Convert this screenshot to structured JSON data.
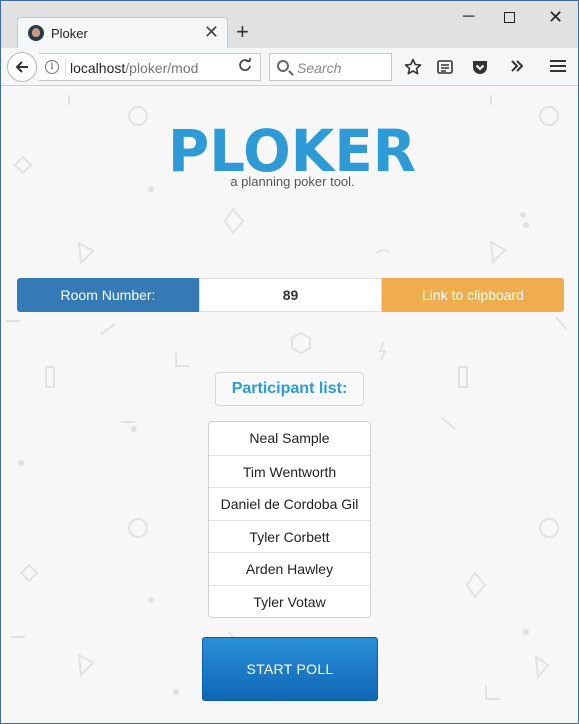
{
  "browser": {
    "tab_title": "Ploker",
    "tab_close": "✕",
    "new_tab": "+",
    "url_host": "localhost",
    "url_path": "/ploker/mod",
    "search_placeholder": "Search",
    "window_controls": {
      "minimize": "─",
      "close": "✕"
    }
  },
  "page": {
    "logo_text": "PLOKER",
    "tagline": "a planning poker tool.",
    "room": {
      "label": "Room Number:",
      "number": "89",
      "clipboard_button": "Link to clipboard"
    },
    "participants": {
      "title": "Participant list:",
      "items": [
        "Neal Sample",
        "Tim Wentworth",
        "Daniel de Cordoba Gil",
        "Tyler Corbett",
        "Arden Hawley",
        "Tyler Votaw"
      ]
    },
    "start_button": "START POLL"
  },
  "colors": {
    "brand_blue": "#2e9ad6",
    "room_label_bg": "#337ab7",
    "clipboard_bg": "#f0ad4e",
    "start_button": "#1a7ac6"
  }
}
